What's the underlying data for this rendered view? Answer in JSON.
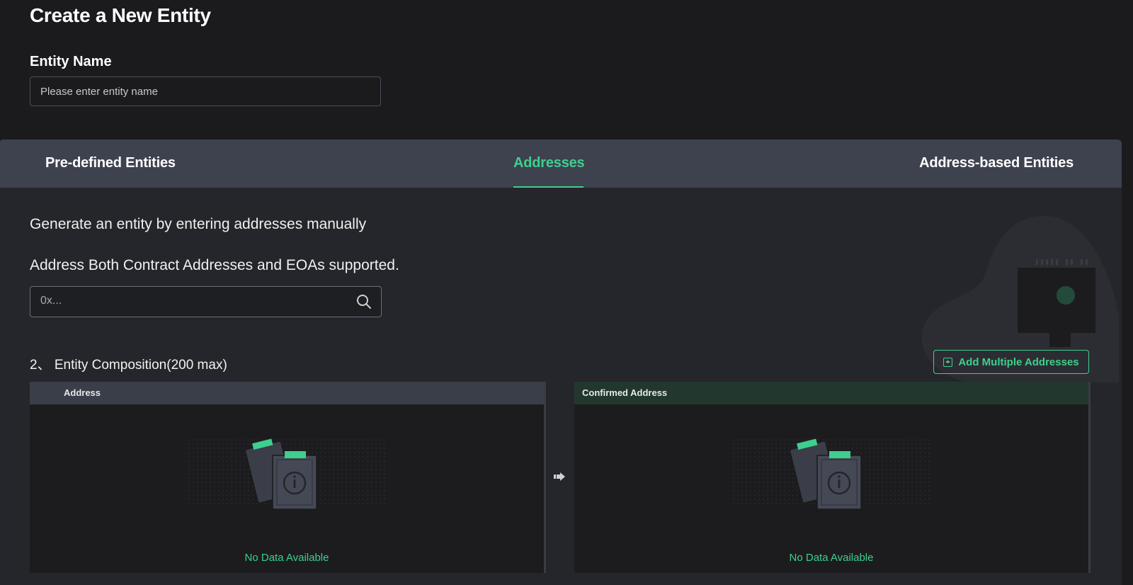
{
  "page": {
    "title": "Create a New Entity"
  },
  "entity_name": {
    "label": "Entity Name",
    "placeholder": "Please enter entity name",
    "value": ""
  },
  "tabs": [
    {
      "label": "Pre-defined Entities",
      "active": false
    },
    {
      "label": "Addresses",
      "active": true
    },
    {
      "label": "Address-based Entities",
      "active": false
    }
  ],
  "addresses": {
    "description": "Generate an entity by entering addresses manually",
    "hint": "Address Both Contract Addresses and EOAs supported.",
    "input_placeholder": "0x...",
    "search_icon": "search-icon"
  },
  "composition": {
    "title": "2、 Entity Composition(200 max)",
    "add_button_label": "Add Multiple Addresses",
    "add_button_icon": "plus-square-icon",
    "left_table": {
      "header": "Address",
      "empty_text": "No Data Available"
    },
    "right_table": {
      "header": "Confirmed Address",
      "empty_text": "No Data Available"
    },
    "transfer_icon": "arrow-right-icon"
  },
  "colors": {
    "accent": "#3ecf8e",
    "background": "#1b1b1e",
    "panel": "#25262b",
    "tab_bar": "#3d424e"
  }
}
